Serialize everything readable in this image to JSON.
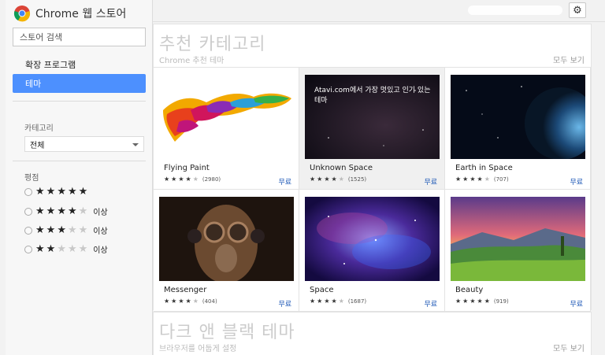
{
  "app": {
    "title": "Chrome 웹 스토어"
  },
  "search": {
    "placeholder": "스토어 검색"
  },
  "nav": [
    {
      "label": "확장 프로그램"
    },
    {
      "label": "테마"
    }
  ],
  "filters": {
    "category_label": "카테고리",
    "category_value": "전체",
    "rating_label": "평점",
    "rating_options": [
      {
        "stars": 5,
        "suffix": ""
      },
      {
        "stars": 4,
        "suffix": "이상"
      },
      {
        "stars": 3,
        "suffix": "이상"
      },
      {
        "stars": 2,
        "suffix": "이상"
      }
    ]
  },
  "sections": [
    {
      "title": "추천 카테고리",
      "subtitle": "Chrome 추천 테마",
      "see_all": "모두 보기",
      "items": [
        {
          "name": "Flying Paint",
          "rating": 4,
          "count": "(2980)",
          "price": "무료",
          "caption": ""
        },
        {
          "name": "Unknown Space",
          "rating": 4,
          "count": "(1525)",
          "price": "무료",
          "caption": "Atavi.com에서 가장 멋있고 인기 있는 테마"
        },
        {
          "name": "Earth in Space",
          "rating": 4,
          "count": "(707)",
          "price": "무료",
          "caption": ""
        },
        {
          "name": "Messenger",
          "rating": 4,
          "count": "(404)",
          "price": "무료",
          "caption": ""
        },
        {
          "name": "Space",
          "rating": 4,
          "count": "(1687)",
          "price": "무료",
          "caption": ""
        },
        {
          "name": "Beauty",
          "rating": 4.5,
          "count": "(919)",
          "price": "무료",
          "caption": ""
        }
      ]
    },
    {
      "title": "다크 앤 블랙 테마",
      "subtitle": "브라우저를 어둡게 설정",
      "see_all": "모두 보기"
    }
  ],
  "icons": {
    "gear": "gear-icon",
    "logo": "chrome-logo-icon",
    "star": "star-icon"
  },
  "colors": {
    "accent": "#4d90fe",
    "price": "#1a55b5"
  }
}
